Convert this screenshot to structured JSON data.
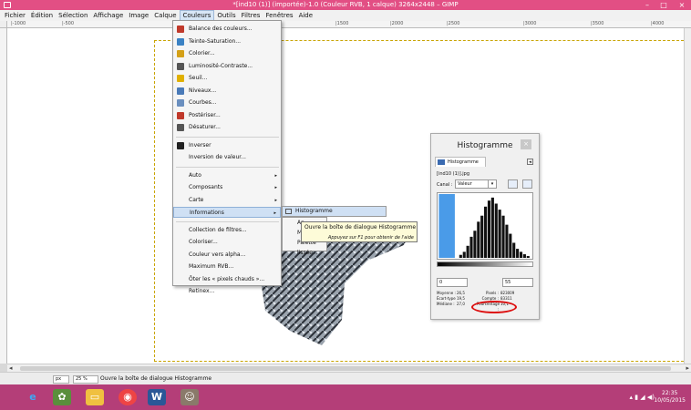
{
  "window": {
    "title": "*[ind10 (1)] (importée)-1.0 (Couleur RVB, 1 calque) 3264x2448 – GIMP",
    "controls": [
      "–",
      "□",
      "×"
    ]
  },
  "menubar": [
    "Fichier",
    "Édition",
    "Sélection",
    "Affichage",
    "Image",
    "Calque",
    "Couleurs",
    "Outils",
    "Filtres",
    "Fenêtres",
    "Aide"
  ],
  "ruler_top": [
    "|-1000",
    "|-500",
    "|1500",
    "|2000",
    "|2500",
    "|3000",
    "|3500",
    "|4000"
  ],
  "couleurs_menu": {
    "items": [
      {
        "label": "Balance des couleurs...",
        "color": "#c0392b"
      },
      {
        "label": "Teinte-Saturation...",
        "color": "#3b82c4"
      },
      {
        "label": "Colorier...",
        "color": "#d4a017"
      },
      {
        "label": "Luminosité-Contraste...",
        "color": "#555555"
      },
      {
        "label": "Seuil...",
        "color": "#e0b000"
      },
      {
        "label": "Niveaux...",
        "color": "#4a7ab8"
      },
      {
        "label": "Courbes...",
        "color": "#6a8fbf"
      },
      {
        "label": "Postériser...",
        "color": "#c0392b"
      },
      {
        "label": "Désaturer...",
        "color": "#555555"
      }
    ],
    "items2": [
      {
        "label": "Inverser",
        "color": "#222222"
      },
      {
        "label": "Inversion de valeur...",
        "color": ""
      }
    ],
    "items3": [
      {
        "label": "Auto",
        "arrow": "▸"
      },
      {
        "label": "Composants",
        "arrow": "▸"
      },
      {
        "label": "Carte",
        "arrow": "▸"
      },
      {
        "label": "Informations",
        "arrow": "▸"
      }
    ],
    "items4": [
      "Collection de filtres...",
      "Coloriser...",
      "Couleur vers alpha...",
      "Maximum RVB...",
      "Ôter les « pixels chauds »...",
      "Retinex..."
    ]
  },
  "submenu": {
    "highlighted": "Histogramme",
    "under": [
      "Ap",
      "Mo",
      "Palette lissée..."
    ]
  },
  "tooltip": {
    "line1": "Ouvre la boîte de dialogue Histogramme",
    "line2": "Appuyez sur F1 pour obtenir de l'aide"
  },
  "histogram_dialog": {
    "title": "Histogramme",
    "close": "×",
    "tab": "Histogramme",
    "image_name": "[ind10 (1)].jpg",
    "canal_label": "Canal :",
    "canal_value": "Valeur",
    "range_min": "0",
    "range_max": "55",
    "stats": [
      {
        "k1": "Moyenne :",
        "v1": "26,5",
        "k2": "Pixels :",
        "v2": "823009"
      },
      {
        "k1": "Écart-type :",
        "v1": "19,5",
        "k2": "Compte :",
        "v2": "83311"
      },
      {
        "k1": "Médiane :",
        "v1": "27,0",
        "k2": "Pourcentage :",
        "v2": "10,1"
      }
    ],
    "chart_bars": [
      0.05,
      0.1,
      0.2,
      0.35,
      0.45,
      0.6,
      0.7,
      0.85,
      0.95,
      1.0,
      0.9,
      0.8,
      0.7,
      0.55,
      0.4,
      0.25,
      0.15,
      0.1,
      0.06,
      0.03
    ]
  },
  "statusbar": {
    "unit": "px",
    "zoom": "25 %",
    "message": "Ouvre la boîte de dialogue Histogramme"
  },
  "taskbar": {
    "clock_time": "22:35",
    "clock_date": "10/05/2015"
  }
}
